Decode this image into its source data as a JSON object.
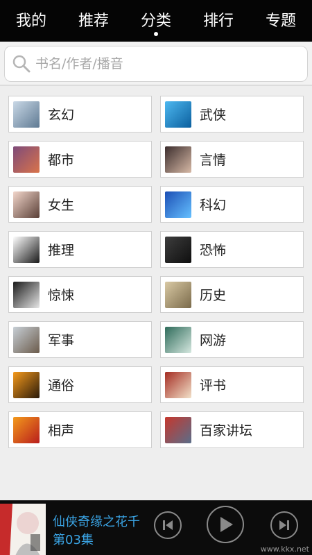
{
  "tabs": [
    {
      "label": "我的"
    },
    {
      "label": "推荐"
    },
    {
      "label": "分类",
      "active": true
    },
    {
      "label": "排行"
    },
    {
      "label": "专题"
    }
  ],
  "search": {
    "placeholder": "书名/作者/播音"
  },
  "categories": [
    {
      "label": "玄幻",
      "icon": "fantasy-thumb",
      "colors": [
        "#c9d8e6",
        "#5f7a93"
      ]
    },
    {
      "label": "武侠",
      "icon": "wuxia-thumb",
      "colors": [
        "#4db8f0",
        "#0b5f9e"
      ]
    },
    {
      "label": "都市",
      "icon": "city-thumb",
      "colors": [
        "#7e4b7a",
        "#d9734a"
      ]
    },
    {
      "label": "言情",
      "icon": "romance-thumb",
      "colors": [
        "#3b2d2d",
        "#d7b9a6"
      ]
    },
    {
      "label": "女生",
      "icon": "girl-thumb",
      "colors": [
        "#f3d7cc",
        "#5a3f36"
      ]
    },
    {
      "label": "科幻",
      "icon": "scifi-thumb",
      "colors": [
        "#1b4fb5",
        "#66c0ff"
      ]
    },
    {
      "label": "推理",
      "icon": "detective-thumb",
      "colors": [
        "#ffffff",
        "#1a1a1a"
      ]
    },
    {
      "label": "恐怖",
      "icon": "horror-thumb",
      "colors": [
        "#3d3d3d",
        "#0f0f0f"
      ]
    },
    {
      "label": "惊悚",
      "icon": "thriller-thumb",
      "colors": [
        "#1a1a1a",
        "#e6e6e6"
      ]
    },
    {
      "label": "历史",
      "icon": "history-thumb",
      "colors": [
        "#d9c9a4",
        "#7a6a4a"
      ]
    },
    {
      "label": "军事",
      "icon": "military-thumb",
      "colors": [
        "#c7cfd6",
        "#6b5b4b"
      ]
    },
    {
      "label": "网游",
      "icon": "game-thumb",
      "colors": [
        "#2e6b5a",
        "#d6e8e0"
      ]
    },
    {
      "label": "通俗",
      "icon": "popular-thumb",
      "colors": [
        "#f59a1c",
        "#2a1a0a"
      ]
    },
    {
      "label": "评书",
      "icon": "storytelling-thumb",
      "colors": [
        "#a42c22",
        "#f2e1c9"
      ]
    },
    {
      "label": "相声",
      "icon": "crosstalk-fan-thumb",
      "colors": [
        "#f39a1b",
        "#b91d1d"
      ]
    },
    {
      "label": "百家讲坛",
      "icon": "lecture-logo-thumb",
      "colors": [
        "#c6372d",
        "#5a6e8a"
      ]
    }
  ],
  "player": {
    "title": "仙侠奇缘之花千",
    "episode": "第03集",
    "cover_colors": [
      "#ffffff",
      "#c62b2b"
    ]
  },
  "watermark": "www.kkx.net"
}
